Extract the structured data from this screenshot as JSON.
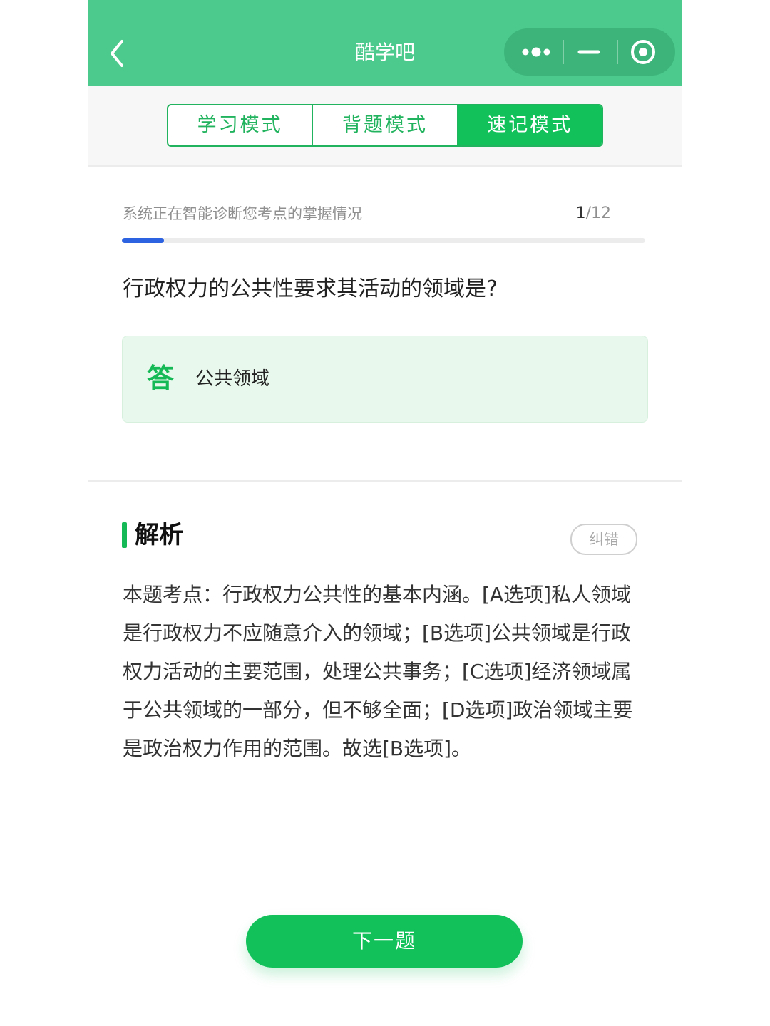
{
  "header": {
    "title": "酷学吧",
    "back_icon": "chevron-left-icon",
    "more_icon": "more-dots-icon",
    "minimize_icon": "minimize-icon",
    "close_icon": "target-circle-icon",
    "background_color": "#4cc98c"
  },
  "mode_tabs": [
    {
      "label": "学习模式",
      "active": false
    },
    {
      "label": "背题模式",
      "active": false
    },
    {
      "label": "速记模式",
      "active": true
    }
  ],
  "progress": {
    "status_text": "系统正在智能诊断您考点的掌握情况",
    "current": "1",
    "separator": "/",
    "total": "12",
    "fraction": 0.08,
    "fill_color": "#2d62e0"
  },
  "question": {
    "text": "行政权力的公共性要求其活动的领域是?"
  },
  "answer": {
    "mark": "答",
    "text": "公共领域"
  },
  "explanation": {
    "title": "解析",
    "report_label": "纠错",
    "body": "本题考点：行政权力公共性的基本内涵。[A选项]私人领域是行政权力不应随意介入的领域；[B选项]公共领域是行政权力活动的主要范围，处理公共事务；[C选项]经济领域属于公共领域的一部分，但不够全面；[D选项]政治领域主要是政治权力作用的范围。故选[B选项]。"
  },
  "footer": {
    "next_label": "下一题"
  },
  "colors": {
    "accent_green": "#12c15a",
    "answer_bg": "#e8f8ec"
  }
}
